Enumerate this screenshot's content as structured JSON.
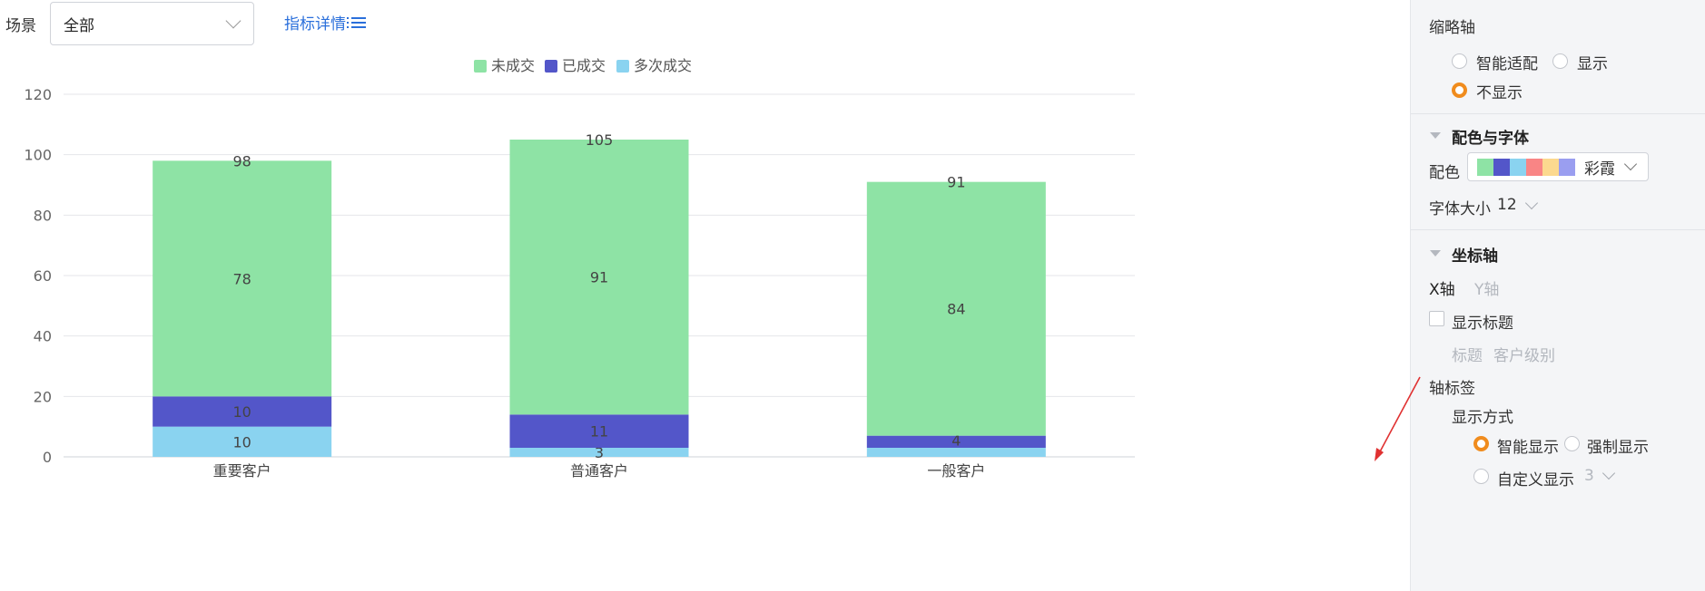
{
  "toolbar": {
    "scene_label": "场景",
    "scene_value": "全部",
    "metric_link": "指标详情"
  },
  "chart_data": {
    "type": "bar",
    "stacked": true,
    "categories": [
      "重要客户",
      "普通客户",
      "一般客户"
    ],
    "series": [
      {
        "name": "多次成交",
        "color": "#8ad3f0",
        "values": [
          10,
          3,
          3
        ]
      },
      {
        "name": "已成交",
        "color": "#5356c9",
        "values": [
          10,
          11,
          4
        ]
      },
      {
        "name": "未成交",
        "color": "#8ee3a5",
        "values": [
          78,
          91,
          84
        ]
      }
    ],
    "segment_labels": [
      [
        "10",
        "10",
        "78"
      ],
      [
        "3",
        "11",
        "91"
      ],
      [
        "",
        "4",
        "84"
      ]
    ],
    "totals": [
      98,
      105,
      91
    ],
    "legend": [
      "未成交",
      "已成交",
      "多次成交"
    ],
    "legend_position": "top",
    "ylim": [
      0,
      120
    ],
    "yticks": [
      0,
      20,
      40,
      60,
      80,
      100,
      120
    ],
    "grid": true
  },
  "panel": {
    "thumb_axis": {
      "title": "缩略轴",
      "options": [
        "智能适配",
        "显示",
        "不显示"
      ],
      "selected": "不显示"
    },
    "color_font": {
      "title": "配色与字体",
      "color_label": "配色",
      "palette": [
        "#8ee3a5",
        "#5356c9",
        "#8ad3f0",
        "#f98585",
        "#fcd98f",
        "#9a9ef0"
      ],
      "palette_name": "彩霞",
      "font_size_label": "字体大小",
      "font_size_value": "12"
    },
    "axis": {
      "title": "坐标轴",
      "tab_x": "X轴",
      "tab_y": "Y轴",
      "show_title_label": "显示标题",
      "title_label": "标题",
      "title_value": "客户级别",
      "axis_tick_label": "轴标签",
      "display_mode_label": "显示方式",
      "display_options": [
        "智能显示",
        "强制显示",
        "自定义显示"
      ],
      "display_selected": "智能显示",
      "custom_value": "3"
    }
  }
}
